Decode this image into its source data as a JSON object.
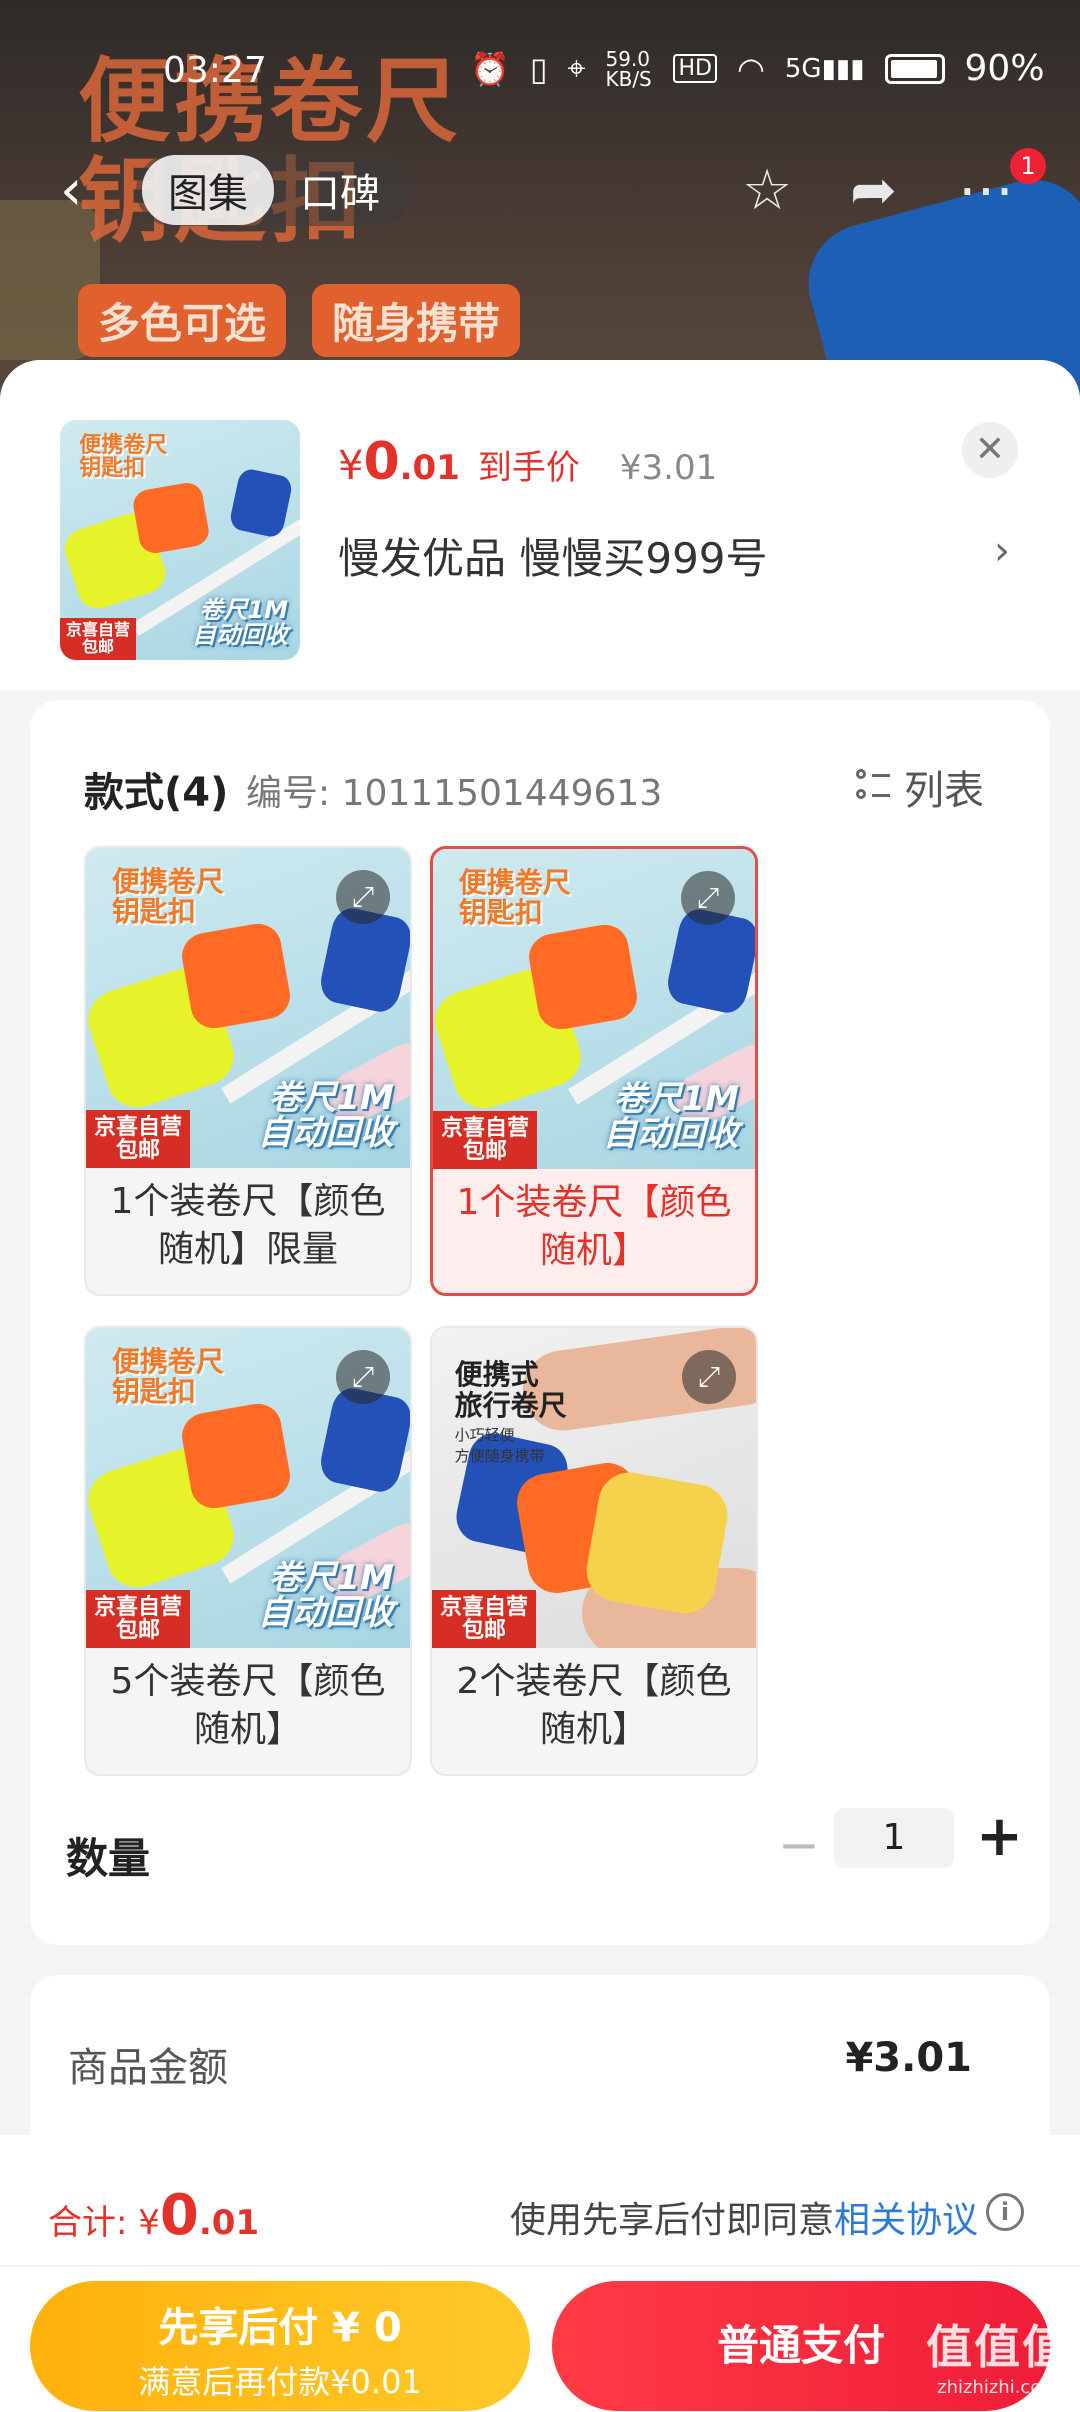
{
  "status_bar": {
    "time": "03:27",
    "net_speed": "59.0 KB/S",
    "hd": "HD",
    "signal": "5G",
    "battery": "90%"
  },
  "hero": {
    "title_line1": "便携卷尺",
    "title_line2": "钥匙扣",
    "chip1": "多色可选",
    "chip2": "随身携带"
  },
  "nav": {
    "tabs": [
      "图集",
      "口碑"
    ],
    "badge": "1"
  },
  "summary": {
    "price_yen": "¥",
    "price_int": "0",
    "price_dec": ".01",
    "price_label": "到手价",
    "original_price": "¥3.01",
    "shop_name": "慢发优品  慢慢买999号"
  },
  "thumb_text": {
    "title_line1": "便携卷尺",
    "title_line2": "钥匙扣",
    "tag1": "多色可选",
    "tag2": "随身携带",
    "jd_line1": "京喜自营",
    "jd_line2": "包邮",
    "auto_line1": "卷尺1M",
    "auto_line2": "自动回收",
    "hand_title1": "便携式",
    "hand_title2": "旅行卷尺",
    "hand_sub1": "小巧轻便",
    "hand_sub2": "方便随身携带"
  },
  "style_section": {
    "heading": "款式(4)",
    "code": "编号: 10111501449613",
    "list_label": "列表",
    "options": [
      {
        "name": "1个装卷尺【颜色随机】限量",
        "selected": false
      },
      {
        "name": "1个装卷尺【颜色随机】",
        "selected": true
      },
      {
        "name": "5个装卷尺【颜色随机】",
        "selected": false
      },
      {
        "name": "2个装卷尺【颜色随机】",
        "selected": false
      }
    ]
  },
  "quantity": {
    "label": "数量",
    "value": "1",
    "minus": "−",
    "plus": "+"
  },
  "amount": {
    "label": "商品金额",
    "value": "¥3.01"
  },
  "bottom_bar": {
    "total_label": "合计: ¥",
    "total_int": "0",
    "total_dec": ".01",
    "agree_text": "使用先享后付即同意",
    "agree_link": "相关协议",
    "later_line1": "先享后付 ¥ 0",
    "later_line2": "满意后再付款¥0.01",
    "pay_label": "普通支付"
  },
  "watermark": {
    "logo": "值值值",
    "url": "zhizhizhi.com"
  },
  "colors": {
    "accent_red": "#e4322a",
    "link_blue": "#2a7bd7",
    "later_yellow": "#ffb10c",
    "pay_red": "#ef1d38"
  }
}
